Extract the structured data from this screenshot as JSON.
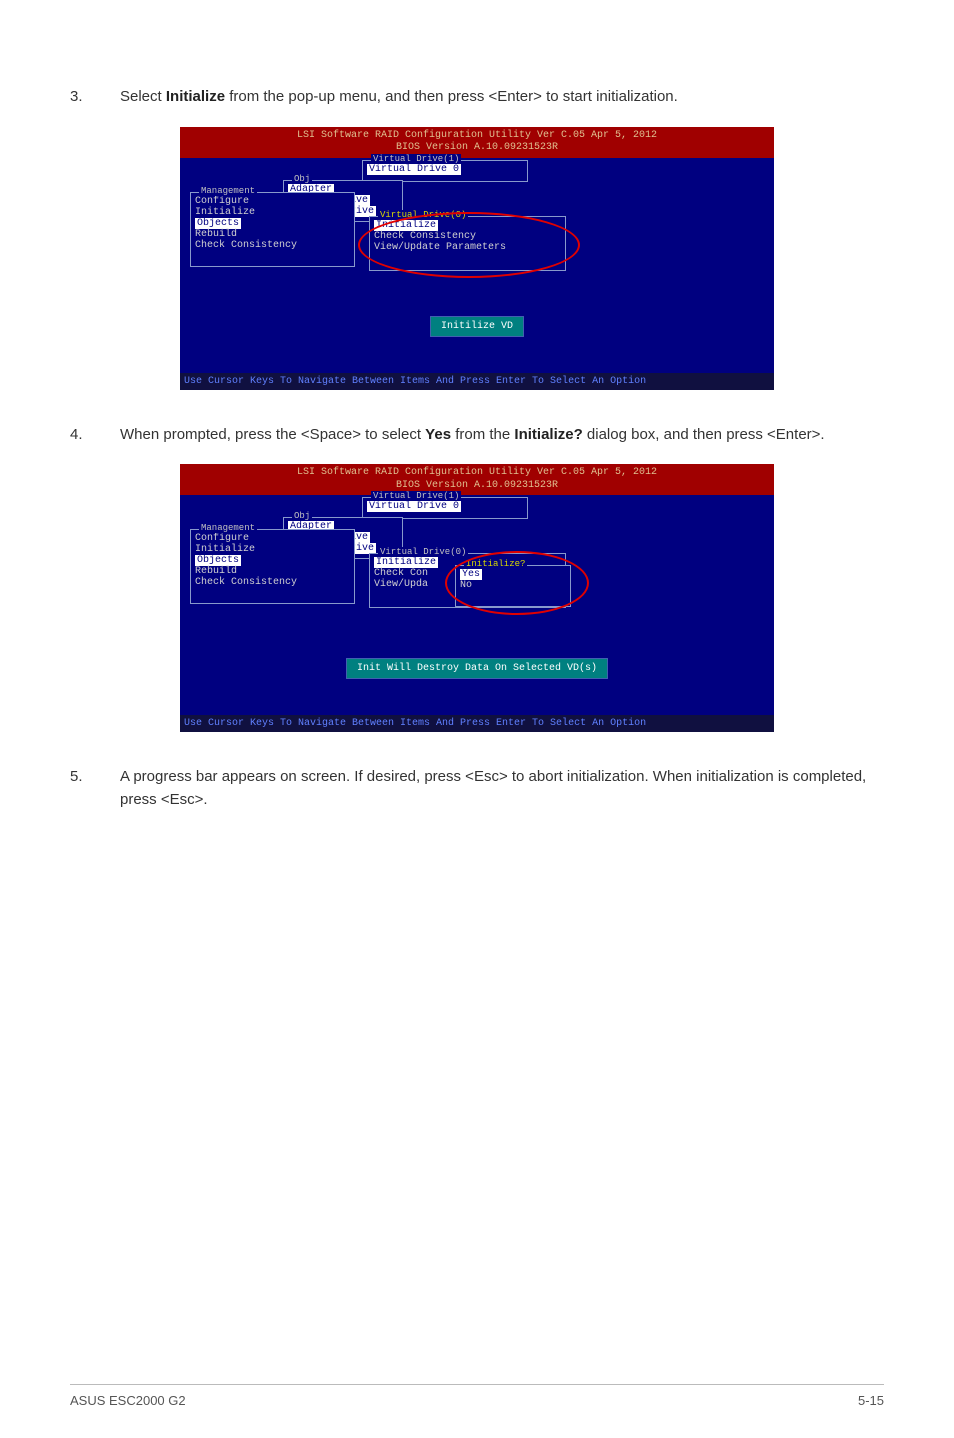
{
  "steps": {
    "s3": {
      "num": "3.",
      "text_a": "Select ",
      "bold_a": "Initialize",
      "text_b": " from the pop-up menu, and then press <Enter> to start initialization."
    },
    "s4": {
      "num": "4.",
      "text_a": "When prompted, press the <Space> to select ",
      "bold_a": "Yes",
      "text_b": " from the ",
      "bold_b": "Initialize?",
      "text_c": " dialog box, and then press <Enter>."
    },
    "s5": {
      "num": "5.",
      "text_a": "A progress bar appears on screen. If desired, press <Esc> to abort initialization. When initialization is completed, press <Esc>."
    }
  },
  "bios": {
    "header_line1": "LSI Software RAID Configuration Utility Ver C.05 Apr 5, 2012",
    "header_line2": "BIOS Version   A.10.09231523R",
    "footer": "Use Cursor Keys To Navigate Between Items And Press Enter To Select An Option",
    "mgmt_label": "Management",
    "mgmt_items": [
      "Configure",
      "Initialize",
      "Objects",
      "Rebuild",
      "Check Consistency"
    ],
    "obj_label": "Obj",
    "obj_items": [
      "Adapter",
      "Virtual Drive",
      "Physical Drive"
    ],
    "vd1_label": "Virtual Drive(1)",
    "vd1_item": "Virtual Drive 0",
    "vd0_label": "Virtual Drive(0)",
    "vd0_items": [
      "Initialize",
      "Check Consistency",
      "View/Update Parameters"
    ],
    "vd0_items2": [
      "Initialize",
      "Check Con",
      "View/Upda"
    ],
    "status1": "Initilize VD",
    "status2": "Init Will Destroy Data On Selected VD(s)",
    "init_label": "Initialize?",
    "init_items": [
      "Yes",
      "No"
    ]
  },
  "footer": {
    "left": "ASUS ESC2000 G2",
    "right": "5-15"
  }
}
